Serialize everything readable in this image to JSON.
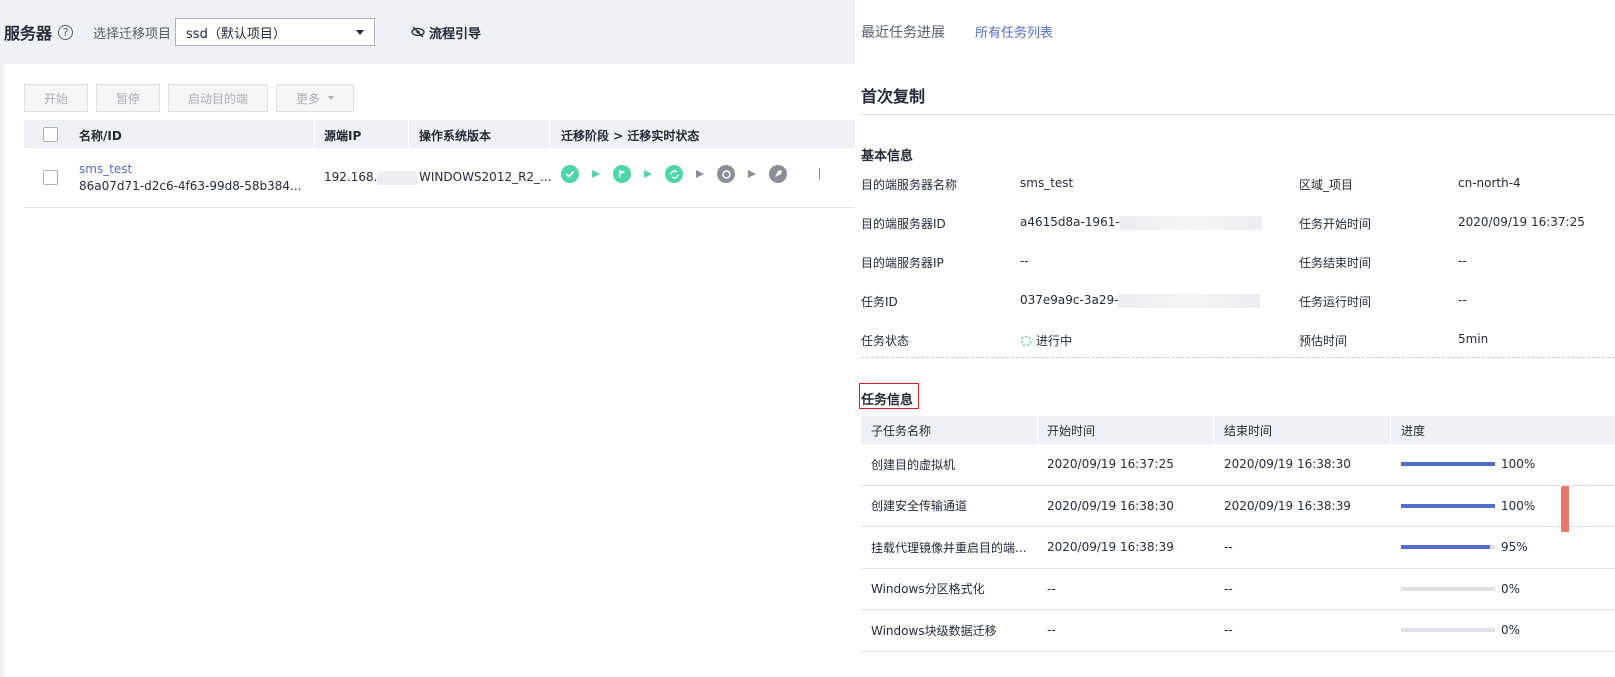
{
  "header": {
    "title": "服务器",
    "help": "?",
    "project_label": "选择迁移项目",
    "project_value": "ssd（默认项目）",
    "guide_label": "流程引导"
  },
  "toolbar": {
    "start": "开始",
    "pause": "暂停",
    "launch_target": "启动目的端",
    "more": "更多"
  },
  "server_table": {
    "columns": [
      "名称/ID",
      "源端IP",
      "操作系统版本",
      "迁移阶段 > 迁移实时状态"
    ],
    "rows": [
      {
        "name": "sms_test",
        "id": "86a07d71-d2c6-4f63-99d8-58b384...",
        "ip": "192.168.",
        "os": "WINDOWS2012_R2_..."
      }
    ]
  },
  "panel": {
    "tab_recent": "最近任务进展",
    "tab_all": "所有任务列表",
    "title": "首次复制",
    "basic_title": "基本信息",
    "basic_left": [
      {
        "label": "目的端服务器名称",
        "value": "sms_test"
      },
      {
        "label": "目的端服务器ID",
        "value": "a4615d8a-1961-"
      },
      {
        "label": "目的端服务器IP",
        "value": "--"
      },
      {
        "label": "任务ID",
        "value": "037e9a9c-3a29-"
      },
      {
        "label": "任务状态",
        "value": "进行中"
      }
    ],
    "basic_right": [
      {
        "label": "区域_项目",
        "value": "cn-north-4"
      },
      {
        "label": "任务开始时间",
        "value": "2020/09/19 16:37:25"
      },
      {
        "label": "任务结束时间",
        "value": "--"
      },
      {
        "label": "任务运行时间",
        "value": "--"
      },
      {
        "label": "预估时间",
        "value": "5min"
      }
    ],
    "task_title": "任务信息",
    "task_columns": [
      "子任务名称",
      "开始时间",
      "结束时间",
      "进度"
    ],
    "tasks": [
      {
        "name": "创建目的虚拟机",
        "start": "2020/09/19 16:37:25",
        "end": "2020/09/19 16:38:30",
        "progress": 100,
        "progress_label": "100%"
      },
      {
        "name": "创建安全传输通道",
        "start": "2020/09/19 16:38:30",
        "end": "2020/09/19 16:38:39",
        "progress": 100,
        "progress_label": "100%"
      },
      {
        "name": "挂载代理镜像并重启目的端...",
        "start": "2020/09/19 16:38:39",
        "end": "--",
        "progress": 95,
        "progress_label": "95%"
      },
      {
        "name": "Windows分区格式化",
        "start": "--",
        "end": "--",
        "progress": 0,
        "progress_label": "0%"
      },
      {
        "name": "Windows块级数据迁移",
        "start": "--",
        "end": "--",
        "progress": 0,
        "progress_label": "0%"
      }
    ]
  },
  "colors": {
    "accent": "#526ecc",
    "success": "#50d4ab",
    "highlight": "#e02020"
  }
}
